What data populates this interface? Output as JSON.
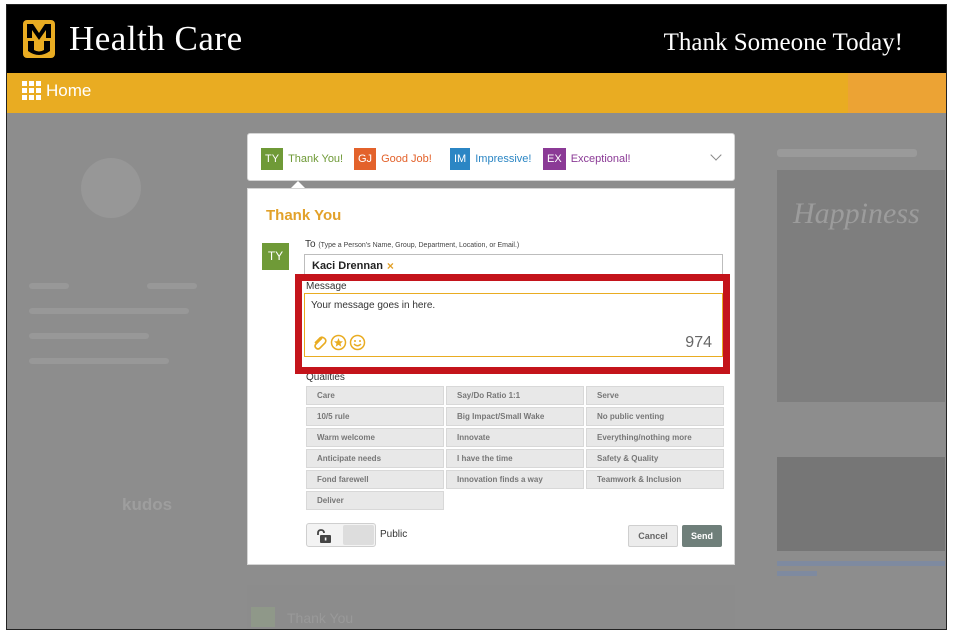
{
  "header": {
    "brand": "Health Care",
    "tagline": "Thank Someone Today!",
    "logo_icon": "university-shield-logo"
  },
  "nav": {
    "home_label": "Home",
    "apps_icon": "grid-icon"
  },
  "tabs": [
    {
      "badge": "TY",
      "label": "Thank You!",
      "color": "#6f9a37"
    },
    {
      "badge": "GJ",
      "label": "Good Job!",
      "color": "#e3622b"
    },
    {
      "badge": "IM",
      "label": "Impressive!",
      "color": "#2b86c4"
    },
    {
      "badge": "EX",
      "label": "Exceptional!",
      "color": "#8b3a96"
    }
  ],
  "form": {
    "title": "Thank You",
    "avatar": "TY",
    "to_label": "To",
    "to_hint": "(Type a Person's Name, Group, Department, Location, or Email.)",
    "recipient": "Kaci Drennan",
    "recipient_remove": "×",
    "message_label": "Message",
    "message_placeholder": "Your message goes in here.",
    "char_count": "974",
    "qualities_label": "Qualities",
    "qualities": [
      "Care",
      "Say/Do Ratio 1:1",
      "Serve",
      "10/5 rule",
      "Big Impact/Small Wake",
      "No public venting",
      "Warm welcome",
      "Innovate",
      "Everything/nothing more",
      "Anticipate needs",
      "I have the time",
      "Safety & Quality",
      "Fond farewell",
      "Innovation finds a way",
      "Teamwork & Inclusion",
      "Deliver"
    ],
    "privacy_label": "Public",
    "cancel_label": "Cancel",
    "send_label": "Send"
  },
  "colors": {
    "accent": "#e9ac22",
    "header_bg": "#000000",
    "highlight": "#c4141b",
    "send_bg": "#6f7f7a"
  }
}
